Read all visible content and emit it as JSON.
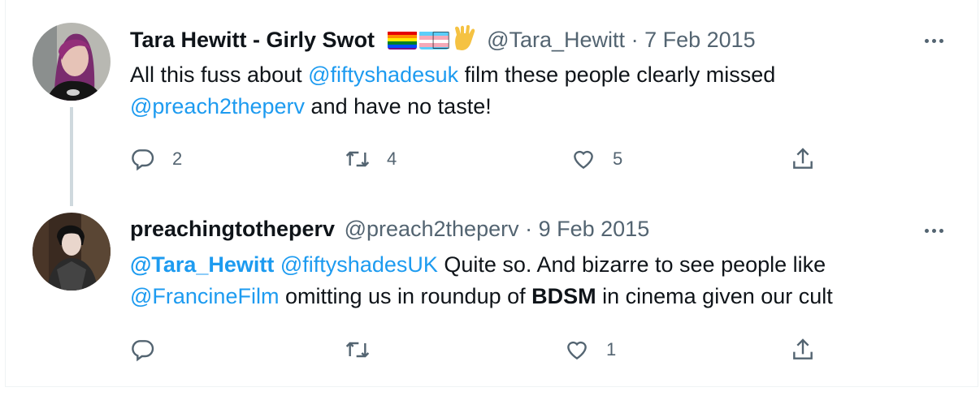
{
  "tweets": [
    {
      "name": "Tara Hewitt - Girly Swot",
      "handle": "@Tara_Hewitt",
      "sep": " · ",
      "date": "7 Feb 2015",
      "emoji_box": "⃞",
      "text_parts": {
        "t1": "All this fuss about ",
        "m1": "@fiftyshadesuk",
        "t2": " film these people clearly missed",
        "m2": "@preach2theperv",
        "t3": " and have no taste!"
      },
      "counts": {
        "reply": "2",
        "retweet": "4",
        "like": "5"
      }
    },
    {
      "name": "preachingtotheperv",
      "handle": "@preach2theperv",
      "sep": " · ",
      "date": "9 Feb 2015",
      "text_parts": {
        "m1": "@Tara_Hewitt",
        "t1": " ",
        "m2": "@fiftyshadesUK",
        "t2": " Quite so. And bizarre to see people like",
        "m3": "@FrancineFilm",
        "t3": " omitting us in roundup of ",
        "b1": "BDSM",
        "t4": " in cinema given our cult"
      },
      "counts": {
        "reply": "",
        "retweet": "",
        "like": "1"
      }
    }
  ],
  "icons": [
    "reply-icon",
    "retweet-icon",
    "like-icon",
    "share-icon",
    "more-icon",
    "pride-flag-icon",
    "trans-flag-icon",
    "vulcan-salute-icon"
  ],
  "colors": {
    "link": "#1d9bf0",
    "muted": "#536471",
    "text": "#0f1419",
    "thread_line": "#cfd9de"
  }
}
